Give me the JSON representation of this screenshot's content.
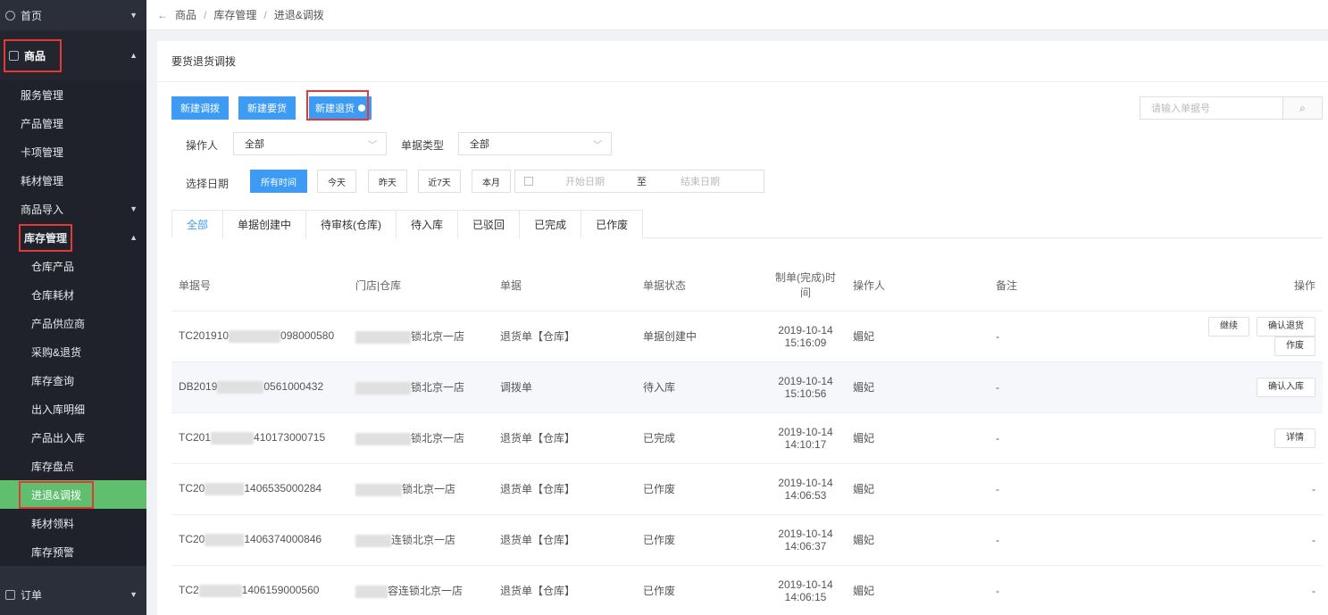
{
  "sidebar": {
    "home": "首页",
    "goods": "商品",
    "sub": [
      "服务管理",
      "产品管理",
      "卡项管理",
      "耗材管理",
      "商品导入",
      "库存管理"
    ],
    "stock_sub": [
      "仓库产品",
      "仓库耗材",
      "产品供应商",
      "采购&退货",
      "库存查询",
      "出入库明细",
      "产品出入库",
      "库存盘点",
      "进退&调拨",
      "耗材领料",
      "库存预警"
    ],
    "order": "订单"
  },
  "breadcrumb": [
    "商品",
    "库存管理",
    "进退&调拨"
  ],
  "panel": {
    "title": "要货退货调拨",
    "btn_transfer": "新建调拨",
    "btn_request": "新建要货",
    "btn_return": "新建退货",
    "search_placeholder": "请输入单据号"
  },
  "filters": {
    "operator_label": "操作人",
    "operator_value": "全部",
    "doctype_label": "单据类型",
    "doctype_value": "全部",
    "date_label": "选择日期",
    "date_buttons": [
      "所有时间",
      "今天",
      "昨天",
      "近7天",
      "本月"
    ],
    "start_placeholder": "开始日期",
    "to": "至",
    "end_placeholder": "结束日期"
  },
  "tabs": [
    "全部",
    "单据创建中",
    "待审核(仓库)",
    "待入库",
    "已驳回",
    "已完成",
    "已作废"
  ],
  "table": {
    "headers": [
      "单据号",
      "门店|仓库",
      "单据",
      "单据状态",
      "制单(完成)时间",
      "操作人",
      "备注",
      "操作"
    ],
    "rows": [
      {
        "no_a": "TC201910",
        "no_b": "098000580",
        "store": "锁北京一店",
        "doc": "退货单【仓库】",
        "status": "单据创建中",
        "date": "2019-10-14",
        "time": "15:16:09",
        "op": "媚妃",
        "note": "-",
        "actions": [
          "继续",
          "确认退货",
          "作废"
        ]
      },
      {
        "no_a": "DB2019",
        "no_b": "0561000432",
        "store": "锁北京一店",
        "doc": "调拨单",
        "status": "待入库",
        "date": "2019-10-14",
        "time": "15:10:56",
        "op": "媚妃",
        "note": "-",
        "actions": [
          "确认入库"
        ]
      },
      {
        "no_a": "TC201",
        "no_b": "410173000715",
        "store": "锁北京一店",
        "doc": "退货单【仓库】",
        "status": "已完成",
        "date": "2019-10-14",
        "time": "14:10:17",
        "op": "媚妃",
        "note": "-",
        "actions": [
          "详情"
        ]
      },
      {
        "no_a": "TC20",
        "no_b": "1406535000284",
        "store": "锁北京一店",
        "doc": "退货单【仓库】",
        "status": "已作废",
        "date": "2019-10-14",
        "time": "14:06:53",
        "op": "媚妃",
        "note": "-",
        "actions": [],
        "dash": "-"
      },
      {
        "no_a": "TC20",
        "no_b": "1406374000846",
        "store": "连锁北京一店",
        "doc": "退货单【仓库】",
        "status": "已作废",
        "date": "2019-10-14",
        "time": "14:06:37",
        "op": "媚妃",
        "note": "-",
        "actions": [],
        "dash": "-"
      },
      {
        "no_a": "TC2",
        "no_b": "1406159000560",
        "store": "容连锁北京一店",
        "doc": "退货单【仓库】",
        "status": "已作废",
        "date": "2019-10-14",
        "time": "14:06:15",
        "op": "媚妃",
        "note": "-",
        "actions": [],
        "dash": "-"
      }
    ]
  },
  "colors": {
    "sidebar": "#2b2f3a",
    "active": "#5fbf6f",
    "primary": "#3d9bf4",
    "highlight": "#e53935"
  }
}
